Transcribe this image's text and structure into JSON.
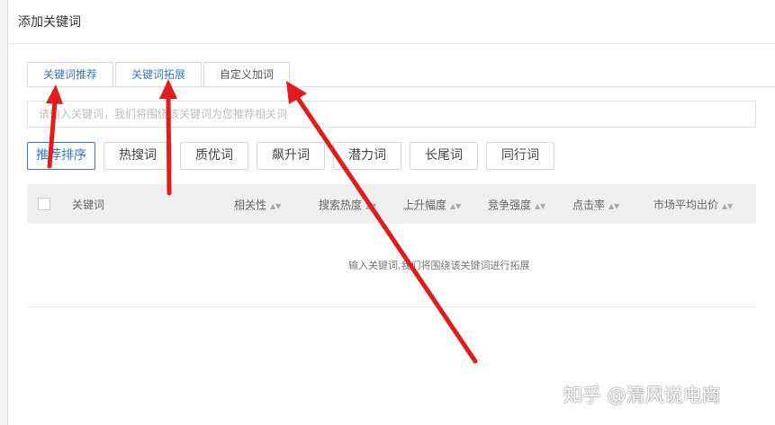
{
  "dialog": {
    "title": "添加关键词"
  },
  "tabs": [
    {
      "label": "关键词推荐"
    },
    {
      "label": "关键词拓展"
    },
    {
      "label": "自定义加词"
    }
  ],
  "search": {
    "placeholder": "请输入关键词，我们将围绕该关键词为您推荐相关词"
  },
  "sort_buttons": [
    {
      "label": "推荐排序"
    },
    {
      "label": "热搜词"
    },
    {
      "label": "质优词"
    },
    {
      "label": "飙升词"
    },
    {
      "label": "潜力词"
    },
    {
      "label": "长尾词"
    },
    {
      "label": "同行词"
    }
  ],
  "table": {
    "columns": [
      {
        "label": "关键词"
      },
      {
        "label": "相关性"
      },
      {
        "label": "搜索热度"
      },
      {
        "label": "上升幅度"
      },
      {
        "label": "竞争强度"
      },
      {
        "label": "点击率"
      },
      {
        "label": "市场平均出价"
      }
    ],
    "empty_text": "输入关键词,我们将围绕该关键词进行拓展"
  },
  "watermark": {
    "text": "知乎 @清风说电商"
  },
  "colors": {
    "accent": "#2f7bd4",
    "arrow": "#e21b1b"
  }
}
